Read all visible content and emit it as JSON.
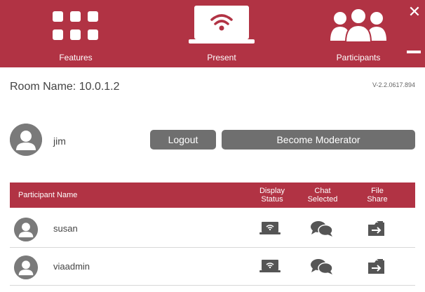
{
  "header": {
    "nav": [
      {
        "label": "Features",
        "icon": "grid-icon"
      },
      {
        "label": "Present",
        "icon": "monitor-wifi-icon"
      },
      {
        "label": "Participants",
        "icon": "people-icon"
      }
    ],
    "close_symbol": "✕"
  },
  "room": {
    "label": "Room Name: 10.0.1.2",
    "version": "V-2.2.0617.894"
  },
  "user": {
    "name": "jim",
    "logout_label": "Logout",
    "moderator_label": "Become Moderator"
  },
  "table": {
    "columns": {
      "name": "Participant Name",
      "display": [
        "Display",
        "Status"
      ],
      "chat": [
        "Chat",
        "Selected"
      ],
      "file": [
        "File",
        "Share"
      ]
    },
    "rows": [
      {
        "name": "susan"
      },
      {
        "name": "viaadmin"
      }
    ]
  },
  "colors": {
    "brand": "#b13344",
    "button": "#6f6f6f",
    "icon": "#555555"
  }
}
